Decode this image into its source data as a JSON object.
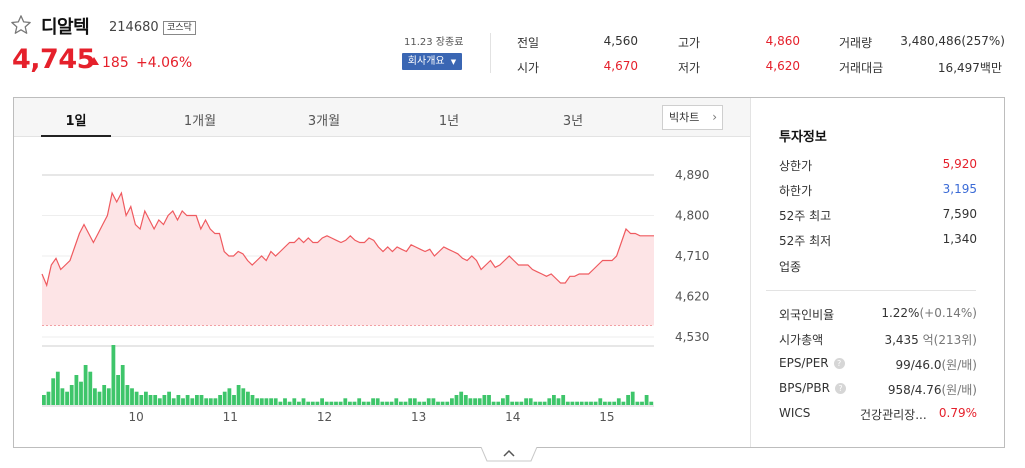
{
  "stock": {
    "name": "디알텍",
    "code": "214680",
    "market": "코스닥",
    "price": "4,745",
    "change_abs": "185",
    "change_pct": "+4.06%"
  },
  "header": {
    "close_time": "11.23 장종료",
    "company_button": "회사개요",
    "quotes": [
      {
        "label": "전일",
        "value": "4,560",
        "color": "dark"
      },
      {
        "label": "시가",
        "value": "4,670",
        "color": "red"
      },
      {
        "label": "고가",
        "value": "4,860",
        "color": "red"
      },
      {
        "label": "저가",
        "value": "4,620",
        "color": "red"
      },
      {
        "label": "거래량",
        "value": "3,480,486(257%)",
        "color": "dark"
      },
      {
        "label": "거래대금",
        "value": "16,497백만",
        "color": "dark"
      }
    ]
  },
  "tabs": [
    "1일",
    "1개월",
    "3개월",
    "1년",
    "3년"
  ],
  "active_tab": "1일",
  "bigchart_label": "빅차트",
  "colors": {
    "up": "#e5202b",
    "down": "#3b6bd6",
    "volume": "#3ec56a",
    "line": "#ef5a5f"
  },
  "chart_data": {
    "type": "line",
    "y_ticks": [
      "4,890",
      "4,800",
      "4,710",
      "4,620",
      "4,530"
    ],
    "ylim": [
      4530,
      4890
    ],
    "x_ticks": [
      "10",
      "11",
      "12",
      "13",
      "14",
      "15"
    ],
    "x_tick_times": [
      10,
      11,
      12,
      13,
      14,
      15
    ],
    "xlim": [
      9.0,
      15.5
    ],
    "prev_close": 4560,
    "price_series": [
      4670,
      4645,
      4690,
      4705,
      4680,
      4690,
      4700,
      4730,
      4760,
      4780,
      4760,
      4740,
      4760,
      4780,
      4800,
      4850,
      4830,
      4850,
      4800,
      4820,
      4780,
      4770,
      4810,
      4790,
      4770,
      4790,
      4780,
      4800,
      4810,
      4790,
      4810,
      4800,
      4800,
      4800,
      4770,
      4790,
      4770,
      4760,
      4760,
      4720,
      4710,
      4710,
      4720,
      4715,
      4700,
      4690,
      4700,
      4710,
      4700,
      4720,
      4710,
      4720,
      4730,
      4740,
      4740,
      4750,
      4740,
      4750,
      4740,
      4740,
      4750,
      4755,
      4750,
      4745,
      4740,
      4745,
      4755,
      4745,
      4740,
      4740,
      4750,
      4745,
      4730,
      4720,
      4730,
      4720,
      4730,
      4725,
      4720,
      4735,
      4730,
      4725,
      4720,
      4725,
      4710,
      4720,
      4730,
      4725,
      4720,
      4715,
      4705,
      4700,
      4710,
      4700,
      4680,
      4690,
      4700,
      4685,
      4690,
      4700,
      4710,
      4700,
      4690,
      4690,
      4690,
      4680,
      4675,
      4670,
      4665,
      4670,
      4660,
      4650,
      4650,
      4665,
      4665,
      4670,
      4670,
      4670,
      4680,
      4690,
      4700,
      4700,
      4700,
      4710,
      4740,
      4770,
      4760,
      4760,
      4755,
      4755,
      4755,
      4755
    ],
    "volume_series": [
      3,
      4,
      8,
      10,
      5,
      4,
      6,
      9,
      7,
      12,
      10,
      5,
      4,
      6,
      5,
      18,
      9,
      12,
      6,
      5,
      4,
      3,
      4,
      3,
      3,
      2,
      3,
      4,
      2,
      3,
      2,
      3,
      2,
      3,
      3,
      2,
      2,
      2,
      3,
      4,
      5,
      3,
      6,
      5,
      4,
      3,
      2,
      2,
      2,
      2,
      2,
      1,
      2,
      1,
      2,
      1,
      2,
      1,
      1,
      1,
      2,
      1,
      1,
      1,
      1,
      2,
      1,
      1,
      2,
      1,
      1,
      2,
      2,
      1,
      1,
      1,
      2,
      1,
      1,
      2,
      2,
      1,
      1,
      2,
      2,
      1,
      1,
      1,
      2,
      3,
      4,
      3,
      2,
      2,
      2,
      3,
      3,
      1,
      1,
      2,
      3,
      1,
      1,
      1,
      2,
      2,
      1,
      1,
      1,
      2,
      3,
      2,
      3,
      1,
      1,
      1,
      1,
      1,
      1,
      1,
      2,
      1,
      1,
      1,
      2,
      1,
      3,
      4,
      1,
      1,
      3,
      1
    ],
    "volume_max": 18
  },
  "investment": {
    "title": "투자정보",
    "rows1": [
      {
        "label": "상한가",
        "value": "5,920",
        "color": "red"
      },
      {
        "label": "하한가",
        "value": "3,195",
        "color": "blue"
      },
      {
        "label": "52주 최고",
        "value": "7,590",
        "color": "dark"
      },
      {
        "label": "52주 최저",
        "value": "1,340",
        "color": "dark"
      },
      {
        "label": "업종",
        "value": "",
        "color": "dark"
      }
    ],
    "foreign_label": "외국인비율",
    "foreign_value": "1.22%",
    "foreign_change": "(+0.14%)",
    "mcap_label": "시가총액",
    "mcap_value": "3,435",
    "mcap_unit": "억(213위)",
    "eps_label": "EPS/PER",
    "eps_value": "99/46.0",
    "eps_unit": "(원/배)",
    "bps_label": "BPS/PBR",
    "bps_value": "958/4.76",
    "bps_unit": "(원/배)",
    "wics_label": "WICS",
    "wics_value": "건강관리장...",
    "wics_pct": "0.79%",
    "help_mark": "?"
  }
}
